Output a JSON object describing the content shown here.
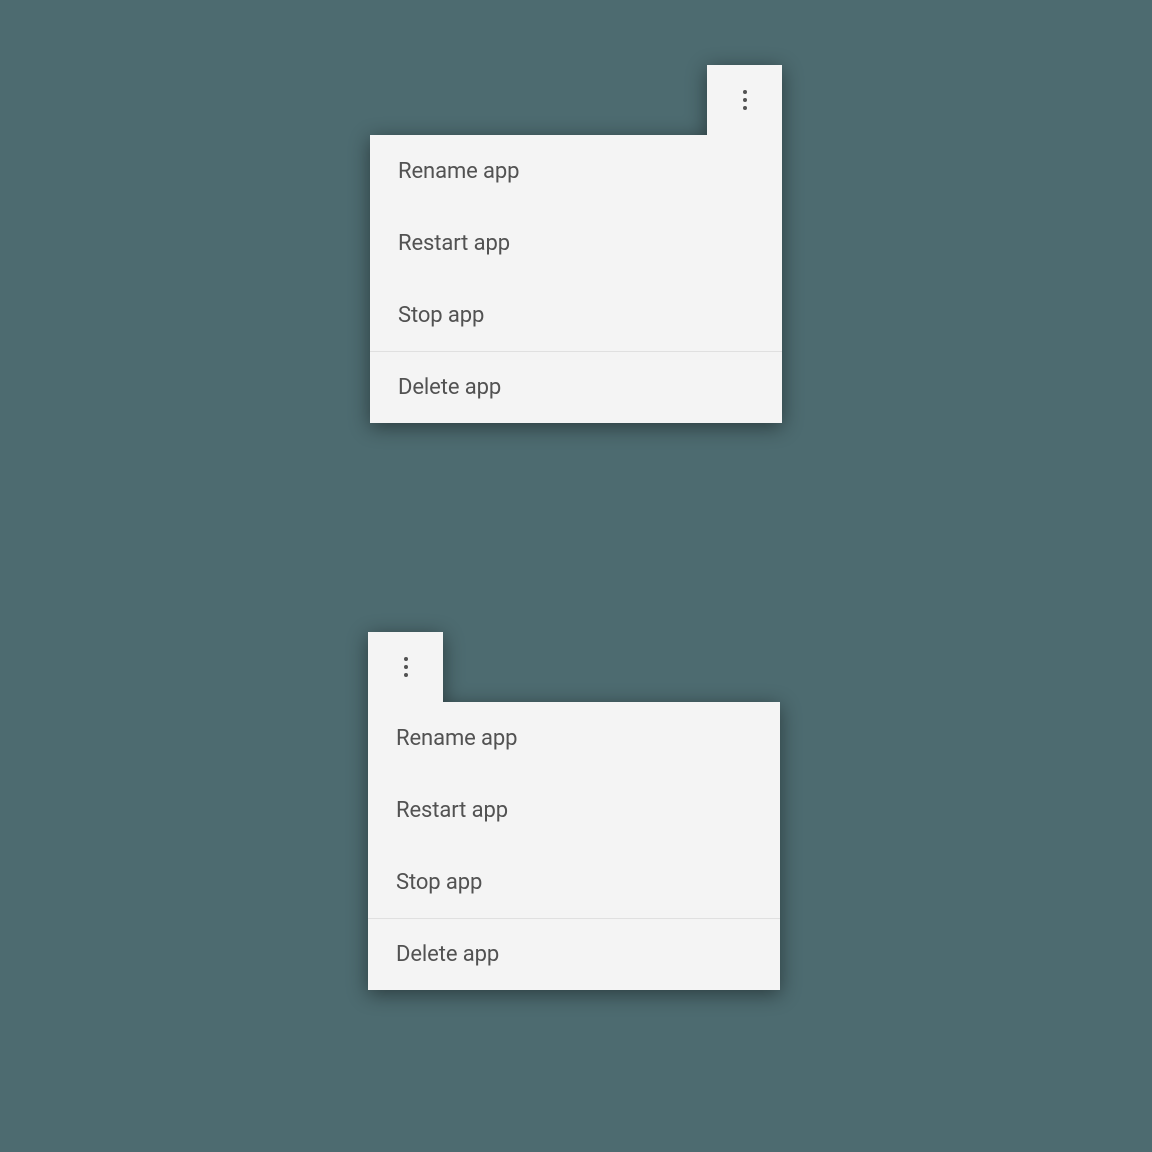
{
  "menu": {
    "items": [
      {
        "label": "Rename app"
      },
      {
        "label": "Restart app"
      },
      {
        "label": "Stop app"
      },
      {
        "label": "Delete app"
      }
    ]
  }
}
